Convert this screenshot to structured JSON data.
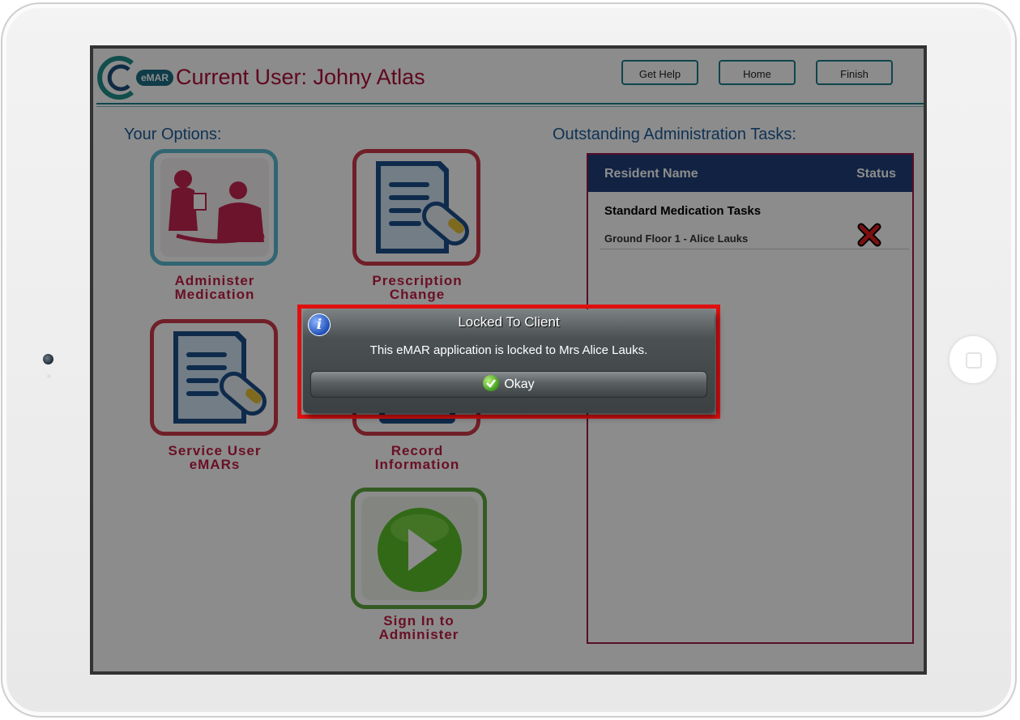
{
  "header": {
    "logo_pill": "eMAR",
    "title": "Current User: Johny Atlas",
    "buttons": {
      "help": "Get Help",
      "home": "Home",
      "finish": "Finish"
    }
  },
  "options": {
    "title": "Your Options:",
    "tiles": [
      {
        "line1": "Administer",
        "line2": "Medication",
        "icon": "nurse-patient-icon"
      },
      {
        "line1": "Prescription",
        "line2": "Change",
        "icon": "prescription-document-icon"
      },
      {
        "line1": "Service User",
        "line2": "eMARs",
        "icon": "prescription-document-icon"
      },
      {
        "line1": "Record",
        "line2": "Information",
        "icon": "record-document-icon"
      },
      {
        "line1": "Sign In to",
        "line2": "Administer",
        "icon": "play-icon"
      }
    ]
  },
  "tasks": {
    "title": "Outstanding Administration Tasks:",
    "columns": {
      "name": "Resident Name",
      "status": "Status"
    },
    "group": "Standard Medication Tasks",
    "rows": [
      {
        "name": "Ground Floor 1 - Alice Lauks",
        "status_icon": "red-x-icon"
      }
    ]
  },
  "dialog": {
    "title": "Locked To Client",
    "message": "This eMAR application is locked to Mrs Alice Lauks.",
    "button": "Okay"
  },
  "colors": {
    "accent_teal": "#1c7f8a",
    "title_red": "#b00d3a",
    "table_header": "#1f3f7a",
    "highlight": "#e01010"
  }
}
